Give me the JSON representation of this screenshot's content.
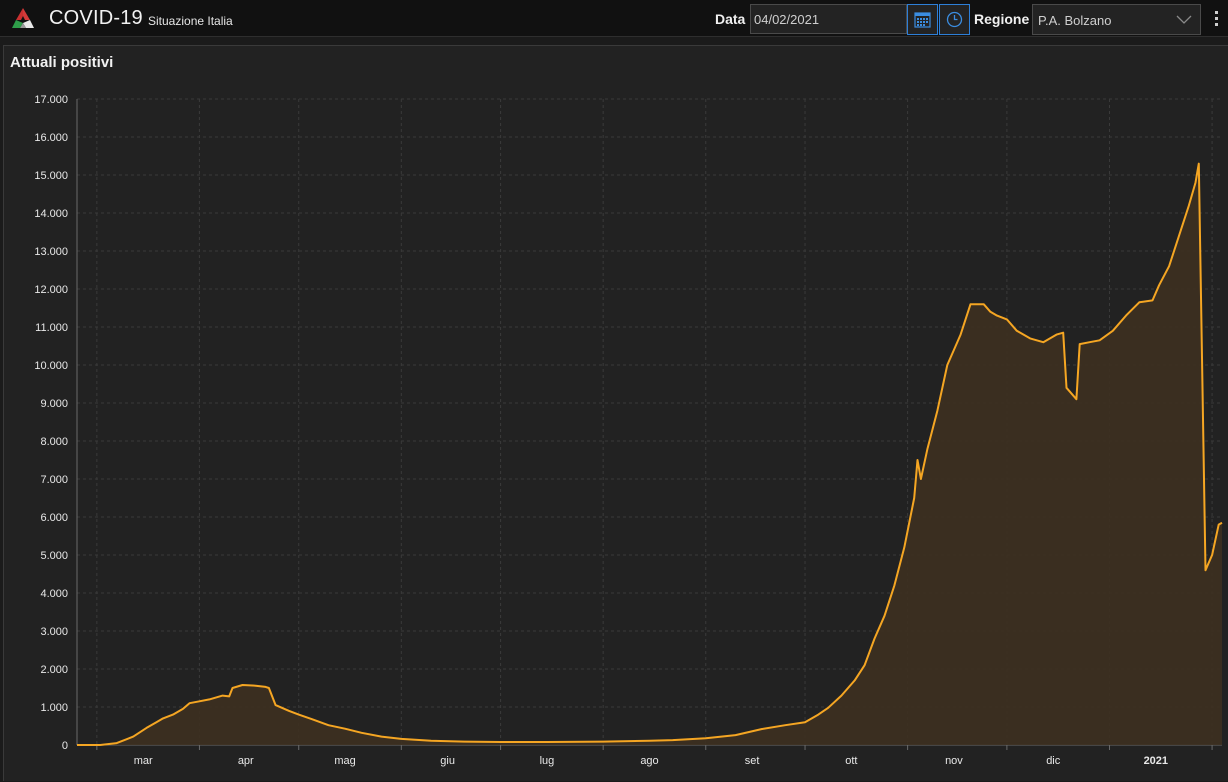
{
  "header": {
    "app_title": "COVID-19",
    "app_subtitle": "Situazione Italia",
    "date_label": "Data",
    "date_value": "04/02/2021",
    "region_label": "Regione",
    "region_value": "P.A. Bolzano",
    "icons": {
      "logo": "tricolor-triangle-logo-icon",
      "calendar": "calendar-icon",
      "clock": "clock-icon",
      "chevron": "chevron-down-icon",
      "menu": "kebab-menu-icon"
    }
  },
  "panel": {
    "title": "Attuali positivi"
  },
  "chart_data": {
    "type": "area",
    "title": "Attuali positivi",
    "xlabel": "",
    "ylabel": "",
    "ylim": [
      0,
      17000
    ],
    "yticks": [
      0,
      1000,
      2000,
      3000,
      4000,
      5000,
      6000,
      7000,
      8000,
      9000,
      10000,
      11000,
      12000,
      13000,
      14000,
      15000,
      16000,
      17000
    ],
    "ytick_labels": [
      "0",
      "1.000",
      "2.000",
      "3.000",
      "4.000",
      "5.000",
      "6.000",
      "7.000",
      "8.000",
      "9.000",
      "10.000",
      "11.000",
      "12.000",
      "13.000",
      "14.000",
      "15.000",
      "16.000",
      "17.000"
    ],
    "xlim": [
      "2020-02-24",
      "2021-02-04"
    ],
    "xticks": [
      {
        "date": "2020-03-15",
        "label": "mar",
        "bold": false
      },
      {
        "date": "2020-04-15",
        "label": "apr",
        "bold": false
      },
      {
        "date": "2020-05-15",
        "label": "mag",
        "bold": false
      },
      {
        "date": "2020-06-15",
        "label": "giu",
        "bold": false
      },
      {
        "date": "2020-07-15",
        "label": "lug",
        "bold": false
      },
      {
        "date": "2020-08-15",
        "label": "ago",
        "bold": false
      },
      {
        "date": "2020-09-15",
        "label": "set",
        "bold": false
      },
      {
        "date": "2020-10-15",
        "label": "ott",
        "bold": false
      },
      {
        "date": "2020-11-15",
        "label": "nov",
        "bold": false
      },
      {
        "date": "2020-12-15",
        "label": "dic",
        "bold": false
      },
      {
        "date": "2021-01-15",
        "label": "2021",
        "bold": true
      }
    ],
    "grid": true,
    "line_color": "#f5a623",
    "fill_color": "#3d3020",
    "series": [
      {
        "name": "",
        "points": [
          [
            "2020-02-24",
            0
          ],
          [
            "2020-03-02",
            0
          ],
          [
            "2020-03-07",
            50
          ],
          [
            "2020-03-12",
            220
          ],
          [
            "2020-03-16",
            450
          ],
          [
            "2020-03-19",
            600
          ],
          [
            "2020-03-21",
            700
          ],
          [
            "2020-03-24",
            800
          ],
          [
            "2020-03-27",
            950
          ],
          [
            "2020-03-29",
            1100
          ],
          [
            "2020-04-01",
            1150
          ],
          [
            "2020-04-04",
            1200
          ],
          [
            "2020-04-08",
            1300
          ],
          [
            "2020-04-10",
            1280
          ],
          [
            "2020-04-11",
            1500
          ],
          [
            "2020-04-14",
            1580
          ],
          [
            "2020-04-18",
            1560
          ],
          [
            "2020-04-21",
            1530
          ],
          [
            "2020-04-22",
            1500
          ],
          [
            "2020-04-24",
            1050
          ],
          [
            "2020-04-28",
            900
          ],
          [
            "2020-05-01",
            800
          ],
          [
            "2020-05-05",
            680
          ],
          [
            "2020-05-10",
            520
          ],
          [
            "2020-05-15",
            430
          ],
          [
            "2020-05-20",
            320
          ],
          [
            "2020-05-26",
            220
          ],
          [
            "2020-06-01",
            160
          ],
          [
            "2020-06-10",
            110
          ],
          [
            "2020-06-20",
            90
          ],
          [
            "2020-07-01",
            80
          ],
          [
            "2020-07-15",
            80
          ],
          [
            "2020-08-01",
            90
          ],
          [
            "2020-08-15",
            110
          ],
          [
            "2020-08-22",
            130
          ],
          [
            "2020-09-01",
            180
          ],
          [
            "2020-09-10",
            260
          ],
          [
            "2020-09-18",
            420
          ],
          [
            "2020-09-25",
            520
          ],
          [
            "2020-10-01",
            600
          ],
          [
            "2020-10-05",
            800
          ],
          [
            "2020-10-08",
            980
          ],
          [
            "2020-10-12",
            1300
          ],
          [
            "2020-10-16",
            1700
          ],
          [
            "2020-10-19",
            2100
          ],
          [
            "2020-10-22",
            2800
          ],
          [
            "2020-10-25",
            3400
          ],
          [
            "2020-10-28",
            4200
          ],
          [
            "2020-10-31",
            5200
          ],
          [
            "2020-11-03",
            6500
          ],
          [
            "2020-11-04",
            7500
          ],
          [
            "2020-11-05",
            7000
          ],
          [
            "2020-11-07",
            7800
          ],
          [
            "2020-11-10",
            8800
          ],
          [
            "2020-11-13",
            10000
          ],
          [
            "2020-11-17",
            10800
          ],
          [
            "2020-11-20",
            11600
          ],
          [
            "2020-11-24",
            11600
          ],
          [
            "2020-11-26",
            11400
          ],
          [
            "2020-11-28",
            11300
          ],
          [
            "2020-12-01",
            11200
          ],
          [
            "2020-12-04",
            10900
          ],
          [
            "2020-12-08",
            10700
          ],
          [
            "2020-12-12",
            10600
          ],
          [
            "2020-12-16",
            10800
          ],
          [
            "2020-12-18",
            10850
          ],
          [
            "2020-12-19",
            9400
          ],
          [
            "2020-12-22",
            9100
          ],
          [
            "2020-12-23",
            10550
          ],
          [
            "2020-12-26",
            10600
          ],
          [
            "2020-12-29",
            10650
          ],
          [
            "2021-01-02",
            10900
          ],
          [
            "2021-01-06",
            11300
          ],
          [
            "2021-01-10",
            11650
          ],
          [
            "2021-01-14",
            11700
          ],
          [
            "2021-01-16",
            12100
          ],
          [
            "2021-01-19",
            12600
          ],
          [
            "2021-01-22",
            13400
          ],
          [
            "2021-01-25",
            14200
          ],
          [
            "2021-01-27",
            14800
          ],
          [
            "2021-01-28",
            15300
          ],
          [
            "2021-01-30",
            4600
          ],
          [
            "2021-02-01",
            5000
          ],
          [
            "2021-02-03",
            5800
          ],
          [
            "2021-02-04",
            5850
          ]
        ]
      }
    ]
  }
}
